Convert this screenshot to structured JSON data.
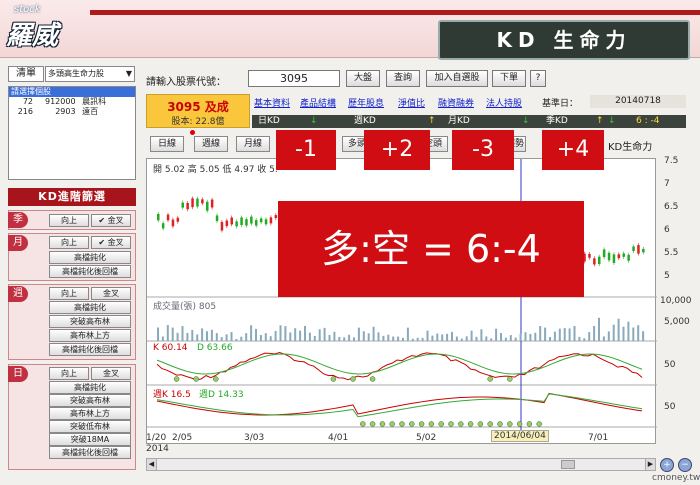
{
  "app": {
    "logo_brand": "羅威",
    "logo_small": "stock",
    "title": "KD 生命力"
  },
  "left": {
    "list_label": "清單",
    "list_selected": "多頭高生命力股",
    "list_items": [
      {
        "text": "請選擇個股",
        "selected": true
      },
      {
        "code": "72",
        "vol": "912000",
        "name": "晨訊科"
      },
      {
        "code": "216",
        "vol": "2903",
        "name": "遠百"
      }
    ],
    "filter_title": "KD進階篩選",
    "sections": [
      {
        "tag": "季",
        "buttons": [
          "向上",
          "✔ 金叉"
        ]
      },
      {
        "tag": "月",
        "buttons": [
          "向上",
          "✔ 金叉",
          "高檔鈍化",
          "高檔鈍化後回檔"
        ]
      },
      {
        "tag": "週",
        "buttons": [
          "向上",
          "金叉",
          "高檔鈍化",
          "突破高布林",
          "高布林上方",
          "高檔鈍化後回檔"
        ]
      },
      {
        "tag": "日",
        "buttons": [
          "向上",
          "金叉",
          "高檔鈍化",
          "突破高布林",
          "高布林上方",
          "突破低布林",
          "突破18MA",
          "高檔鈍化後回檔"
        ]
      }
    ]
  },
  "toolbar": {
    "input_label": "請輸入股票代號：",
    "code_value": "3095",
    "btn_market": "大盤",
    "btn_query": "查詢",
    "btn_add": "加入自選股",
    "btn_order": "下單",
    "btn_help": "?"
  },
  "stock": {
    "name": "3095 及成",
    "capital": "股本: 22.8億"
  },
  "links": [
    "基本資料",
    "產品結構",
    "歷年股息",
    "淨值比",
    "融資融券",
    "法人持股"
  ],
  "ref_date_label": "基準日：",
  "ref_date": "20140718",
  "kdbar": {
    "day": "日KD",
    "week": "週KD",
    "month": "月KD",
    "season": "季KD",
    "score": "6 : -4",
    "arrow_day": "↓",
    "arrow_week": "↑",
    "arrow_month": "↓",
    "arrow_season": "↑"
  },
  "tabs": [
    "日線",
    "週線",
    "月線",
    "多頭",
    "空頭",
    "趨勢",
    "KD生命力"
  ],
  "overlay": {
    "day": "-1",
    "week": "+2",
    "month": "-3",
    "season": "+4",
    "summary": "多:空 = 6:-4"
  },
  "chart": {
    "ohlc_label": "開 5.02 高 5.05 低 4.97 收 5.",
    "price_ticks": [
      "7.5",
      "7",
      "6.5",
      "6",
      "5.5",
      "5"
    ],
    "volume_label": "成交量(張) 805",
    "volume_ticks": [
      "10,000",
      "5,000"
    ],
    "kd_label_k": "K 60.14",
    "kd_label_d": "D 63.66",
    "kd_tick": "50",
    "wkd_label_k": "週K 16.5",
    "wkd_label_d": "週D 14.33",
    "wkd_tick": "50",
    "x_labels": [
      "1/20",
      "2/05",
      "3/03",
      "4/01",
      "5/02",
      "7/01"
    ],
    "x_year": "2014",
    "cursor_date": "2014/06/04"
  },
  "chart_data": {
    "type": "line",
    "x": [
      "1/20",
      "2/05",
      "3/03",
      "4/01",
      "5/02",
      "6/04",
      "7/01"
    ],
    "series": [
      {
        "name": "K",
        "values": [
          60,
          55,
          45,
          50,
          60,
          70,
          60
        ]
      },
      {
        "name": "D",
        "values": [
          60,
          58,
          50,
          52,
          58,
          66,
          64
        ]
      }
    ],
    "ylim": [
      5,
      7.5
    ]
  },
  "watermark": "cmoney.tw",
  "colors": {
    "accent": "#b01a1a",
    "overlay_red": "#d10d14",
    "stock_box": "#f9c63c",
    "kd_bar": "#3c423c"
  }
}
